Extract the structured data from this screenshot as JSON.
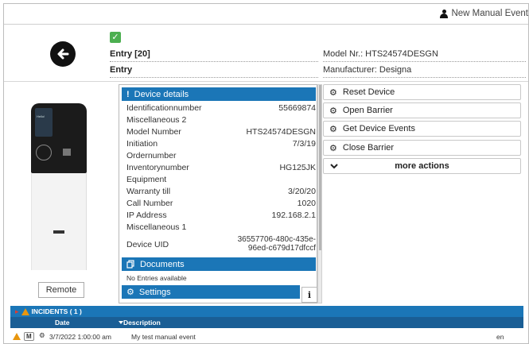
{
  "topbar": {
    "new_event_label": "New Manual Event"
  },
  "header": {
    "entry_title": "Entry [20]",
    "entry_subtitle": "Entry",
    "model_nr": "Model Nr.: HTS24574DESGN",
    "manufacturer": "Manufacturer: Designa"
  },
  "device_image": {
    "screen_text": "Hello!"
  },
  "remote_label": "Remote",
  "details": {
    "header": "Device details",
    "rows": [
      {
        "key": "Identificationnumber",
        "value": "55669874"
      },
      {
        "key": "Miscellaneous 2",
        "value": ""
      },
      {
        "key": "Model Number",
        "value": "HTS24574DESGN"
      },
      {
        "key": "Initiation",
        "value": "7/3/19"
      },
      {
        "key": "Ordernumber",
        "value": ""
      },
      {
        "key": "Inventorynumber",
        "value": "HG125JK"
      },
      {
        "key": "Equipment",
        "value": ""
      },
      {
        "key": "Warranty till",
        "value": "3/20/20"
      },
      {
        "key": "Call Number",
        "value": "1020"
      },
      {
        "key": "IP Address",
        "value": "192.168.2.1"
      },
      {
        "key": "Miscellaneous 1",
        "value": ""
      }
    ],
    "uid_key": "Device UID",
    "uid_line1": "36557706-480c-435e-",
    "uid_line2": "96ed-c679d17dfccf"
  },
  "documents": {
    "header": "Documents",
    "empty_text": "No Entries available"
  },
  "settings": {
    "header": "Settings"
  },
  "info_label": "i",
  "actions": {
    "reset": "Reset Device",
    "open": "Open Barrier",
    "events": "Get Device Events",
    "close": "Close Barrier",
    "more": "more actions"
  },
  "incidents": {
    "header": "INCIDENTS ( 1 )",
    "col_date": "Date",
    "col_desc": "Description",
    "row": {
      "badge": "M",
      "date": "3/7/2022 1:00:00 am",
      "description": "My test manual event",
      "lang": "en"
    }
  },
  "colors": {
    "accent": "#1b76b7",
    "accent_dark": "#1a5e95",
    "success": "#4caf50",
    "warning": "#e8960e"
  }
}
